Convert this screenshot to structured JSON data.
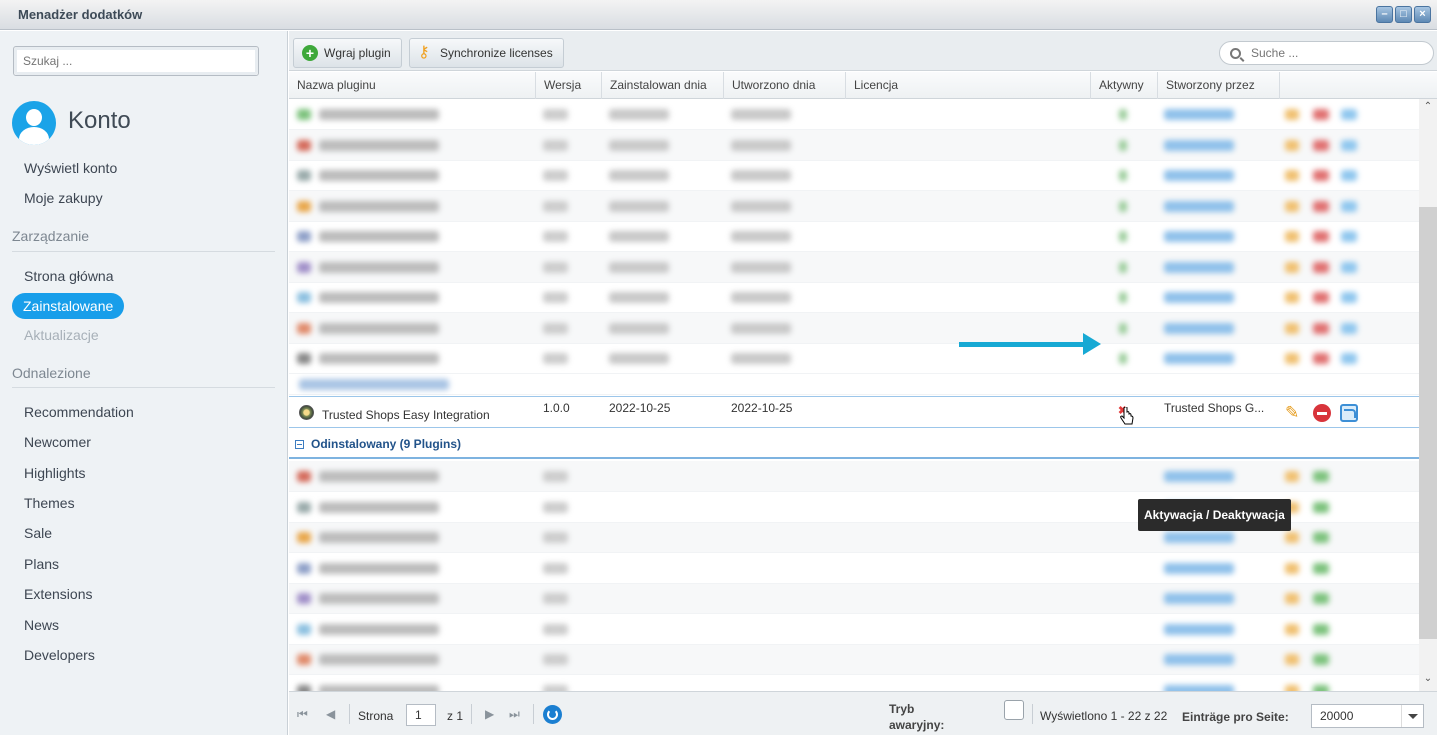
{
  "window": {
    "title": "Menadżer dodatków"
  },
  "sidebar": {
    "search_placeholder": "Szukaj ...",
    "account_name": "Konto",
    "account_items": [
      "Wyświetl konto",
      "Moje zakupy"
    ],
    "manage_section": "Zarządzanie",
    "manage_items": [
      "Strona główna",
      "Zainstalowane",
      "Aktualizacje"
    ],
    "found_section": "Odnalezione",
    "found_items": [
      "Recommendation",
      "Newcomer",
      "Highlights",
      "Themes",
      "Sale",
      "Plans",
      "Extensions",
      "News",
      "Developers"
    ]
  },
  "toolbar": {
    "upload_label": "Wgraj plugin",
    "sync_label": "Synchronize licenses",
    "search_placeholder": "Suche ..."
  },
  "grid": {
    "columns": [
      "Nazwa pluginu",
      "Wersja",
      "Zainstalowan dnia",
      "Utworzono dnia",
      "Licencja",
      "Aktywny",
      "Stworzony przez"
    ],
    "highlighted_row": {
      "name": "Trusted Shops Easy Integration",
      "version": "1.0.0",
      "installed": "2022-10-25",
      "created": "2022-10-25",
      "active_mark": "✖",
      "author": "Trusted Shops G..."
    },
    "uninstalled_group": "Odinstalowany (9 Plugins)",
    "tooltip": "Aktywacja / Deaktywacja"
  },
  "footer": {
    "page_label": "Strona",
    "page_value": "1",
    "page_of": "z 1",
    "safe_mode_label": "Tryb awaryjny:",
    "displayed": "Wyświetlono 1 - 22 z 22",
    "per_page_label": "Einträge pro Seite:",
    "per_page_value": "20000"
  },
  "colors": {
    "accent": "#189eea",
    "arrow": "#17a9d4",
    "link": "#1d82d6"
  }
}
